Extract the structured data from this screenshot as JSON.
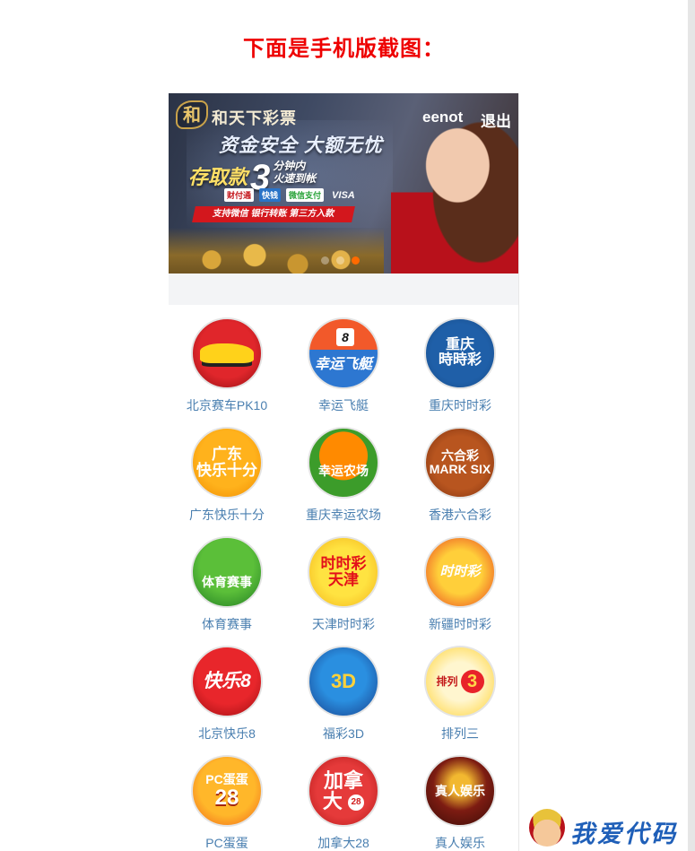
{
  "page": {
    "heading": "下面是手机版截图："
  },
  "banner": {
    "logo_glyph": "和",
    "logo_text": "和天下彩票",
    "slogan_main": "资金安全 大额无忧",
    "slogan_deposit_prefix": "存取款",
    "slogan_deposit_number": "3",
    "slogan_deposit_suffix_top": "分钟内",
    "slogan_deposit_suffix_bottom": "火速到帐",
    "payment_marks": [
      "财付通",
      "快钱",
      "微信支付",
      "VISA"
    ],
    "ribbon_text": "支持微信 银行转账 第三方入款",
    "user_name": "eenot",
    "logout_label": "退出",
    "slide_count": 3,
    "active_slide": 3
  },
  "games": [
    {
      "label": "北京赛车PK10",
      "icon": "race-car-icon",
      "icon_text": ""
    },
    {
      "label": "幸运飞艇",
      "icon": "lucky-airship-icon",
      "icon_text": "幸运飞艇",
      "icon_number": "8"
    },
    {
      "label": "重庆时时彩",
      "icon": "chongqing-ssc-icon",
      "icon_text": "重庆\n時時彩"
    },
    {
      "label": "广东快乐十分",
      "icon": "guangdong-happy-ten-icon",
      "icon_text": "广东\n快乐十分"
    },
    {
      "label": "重庆幸运农场",
      "icon": "lucky-farm-icon",
      "icon_text": "幸运农场"
    },
    {
      "label": "香港六合彩",
      "icon": "mark-six-icon",
      "icon_text": "六合彩\nMARK SIX"
    },
    {
      "label": "体育赛事",
      "icon": "trophy-icon",
      "icon_text": "体育赛事"
    },
    {
      "label": "天津时时彩",
      "icon": "tianjin-ssc-icon",
      "icon_text": "时时彩\n天津"
    },
    {
      "label": "新疆时时彩",
      "icon": "xinjiang-ssc-icon",
      "icon_text": "时时彩"
    },
    {
      "label": "北京快乐8",
      "icon": "happy-8-icon",
      "icon_text": "快乐8"
    },
    {
      "label": "福彩3D",
      "icon": "welfare-3d-icon",
      "icon_text": "3D"
    },
    {
      "label": "排列三",
      "icon": "pailie-three-icon",
      "icon_text": "排列",
      "icon_number": "3"
    },
    {
      "label": "PC蛋蛋",
      "icon": "pc-egg-icon",
      "icon_text": "PC蛋蛋",
      "icon_number": "28"
    },
    {
      "label": "加拿大28",
      "icon": "canada-28-icon",
      "icon_text": "加拿\n大",
      "icon_number": "28"
    },
    {
      "label": "真人娱乐",
      "icon": "live-casino-icon",
      "icon_text": "真人娱乐"
    }
  ],
  "watermark": {
    "text": "我爱代码"
  },
  "colors": {
    "heading": "#ee0000",
    "game_label": "#4a7fb0",
    "active_dot": "#ff6a00",
    "watermark": "#1f5fb8"
  }
}
